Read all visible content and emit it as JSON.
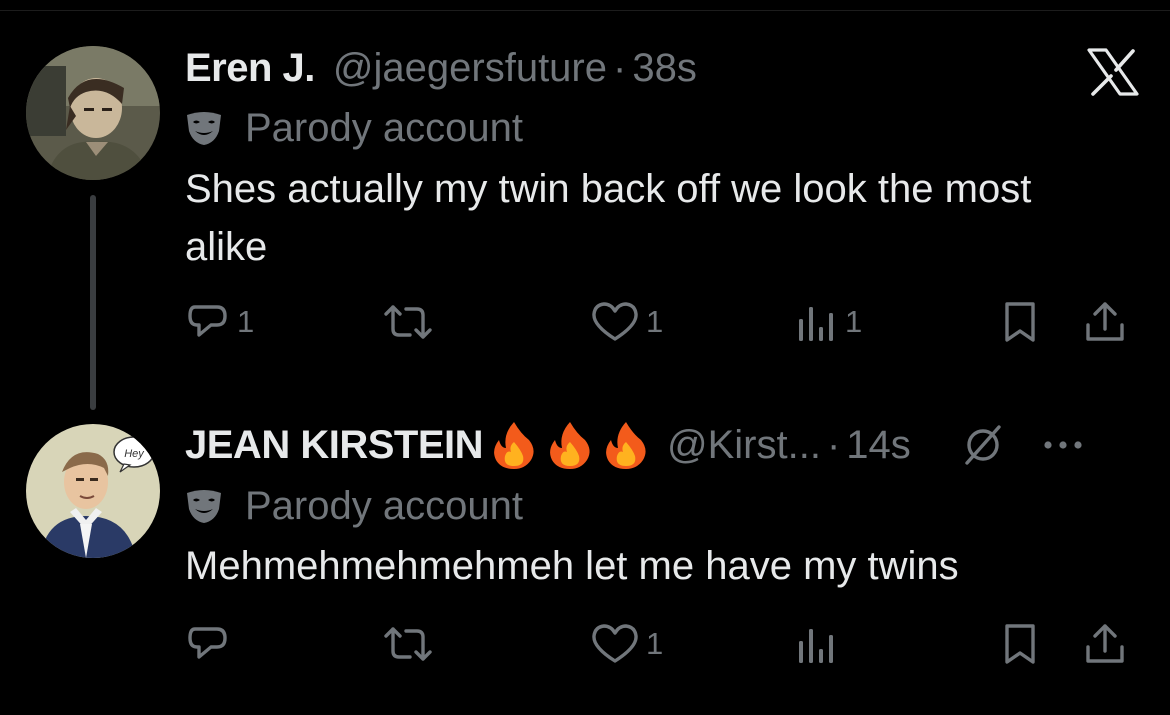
{
  "colors": {
    "background": "#000000",
    "primary_text": "#e7e9ea",
    "secondary_text": "#71767b",
    "thread_line": "#3a3d40"
  },
  "tweets": [
    {
      "display_name": "Eren J.",
      "handle": "@jaegersfuture",
      "separator": "·",
      "time": "38s",
      "badge_label": "Parody account",
      "text": "Shes actually my twin back off we look the most alike",
      "replies": "1",
      "reposts": "",
      "likes": "1",
      "views": "1"
    },
    {
      "display_name": "JEAN KIRSTEIN",
      "name_emojis": [
        "fire-icon",
        "fire-icon",
        "fire-icon"
      ],
      "handle": "@Kirst...",
      "separator": "·",
      "time": "14s",
      "badge_label": "Parody account",
      "text": "Mehmehmehmehmeh let me have my twins",
      "replies": "",
      "reposts": "",
      "likes": "1",
      "views": ""
    }
  ],
  "avatar_speech_bubble": "Hey"
}
